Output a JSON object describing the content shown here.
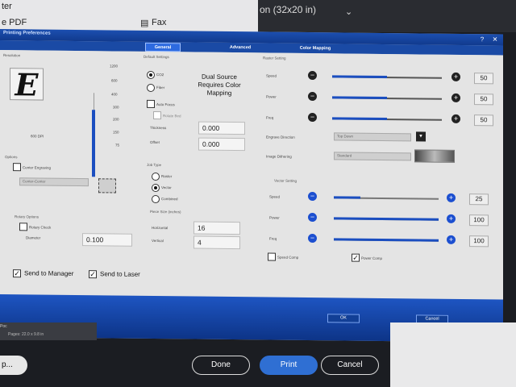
{
  "background": {
    "top_left_text1": "ter",
    "pdf_label": "e PDF",
    "fax_label": "Fax",
    "media_dropdown": "on (32x20 in)",
    "footer_left_text": "Poc",
    "footer_left_sub": "Pages: 22.0 x 9.8 in",
    "left_button": "p...",
    "done": "Done",
    "print": "Print",
    "cancel": "Cancel"
  },
  "dialog": {
    "title": "Printing Preferences",
    "tabs": [
      "General",
      "Advanced",
      "Color Mapping"
    ],
    "footer": {
      "ok": "OK",
      "cancel": "Cancel"
    },
    "resolution": {
      "section": "Resolution",
      "ticks": [
        "1200",
        "600",
        "400",
        "300",
        "200",
        "150",
        "75"
      ],
      "dpi_label": "600 DPI",
      "fill_fraction": 0.8
    },
    "default_settings": {
      "section": "Default Settings",
      "options": [
        "CO2",
        "Fiber"
      ],
      "selected": "CO2",
      "auto_focus": "Auto Focus",
      "rotate_to_bed": "Rotate Bed",
      "thickness_label": "Thickness",
      "thickness": "0.000",
      "offset_label": "Offset",
      "offset": "0.000",
      "notice": "Dual Source Requires Color Mapping"
    },
    "options": {
      "section": "Options",
      "center_engraving": "Center Engraving",
      "center_mode": "Center-Center"
    },
    "rotary": {
      "section": "Rotary Options",
      "rotary_check": "Rotary Check",
      "diameter_label": "Diameter",
      "diameter": "0.100"
    },
    "job_type": {
      "section": "Job Type",
      "options": [
        "Raster",
        "Vector",
        "Combined"
      ],
      "selected": "Vector"
    },
    "piece_size": {
      "section": "Piece Size (inches)",
      "horizontal_label": "Horizontal",
      "horizontal": "16",
      "vertical_label": "Vertical",
      "vertical": "4"
    },
    "raster": {
      "section": "Raster Setting",
      "speed_label": "Speed",
      "power_label": "Power",
      "freq_label": "Freq",
      "speed": "50",
      "power": "50",
      "freq": "50",
      "speed_fill": 0.5,
      "power_fill": 0.5,
      "freq_fill": 0.5,
      "engrave_direction_label": "Engrave Direction",
      "engrave_direction": "Top Down",
      "image_dithering_label": "Image Dithering",
      "image_dithering": "Standard"
    },
    "vector": {
      "section": "Vector Setting",
      "speed_label": "Speed",
      "power_label": "Power",
      "freq_label": "Freq",
      "speed": "25",
      "power": "100",
      "freq": "100",
      "speed_fill": 0.25,
      "power_fill": 1.0,
      "freq_fill": 1.0,
      "speed_comp": "Speed Comp",
      "power_comp": "Power Comp",
      "power_comp_checked": true
    },
    "send_to_manager": "Send to Manager",
    "send_to_laser": "Send to Laser"
  },
  "colors": {
    "accent_blue": "#1b4ec0",
    "titlebar_blue": "#1c4fb0",
    "print_button": "#2f6fd3"
  }
}
